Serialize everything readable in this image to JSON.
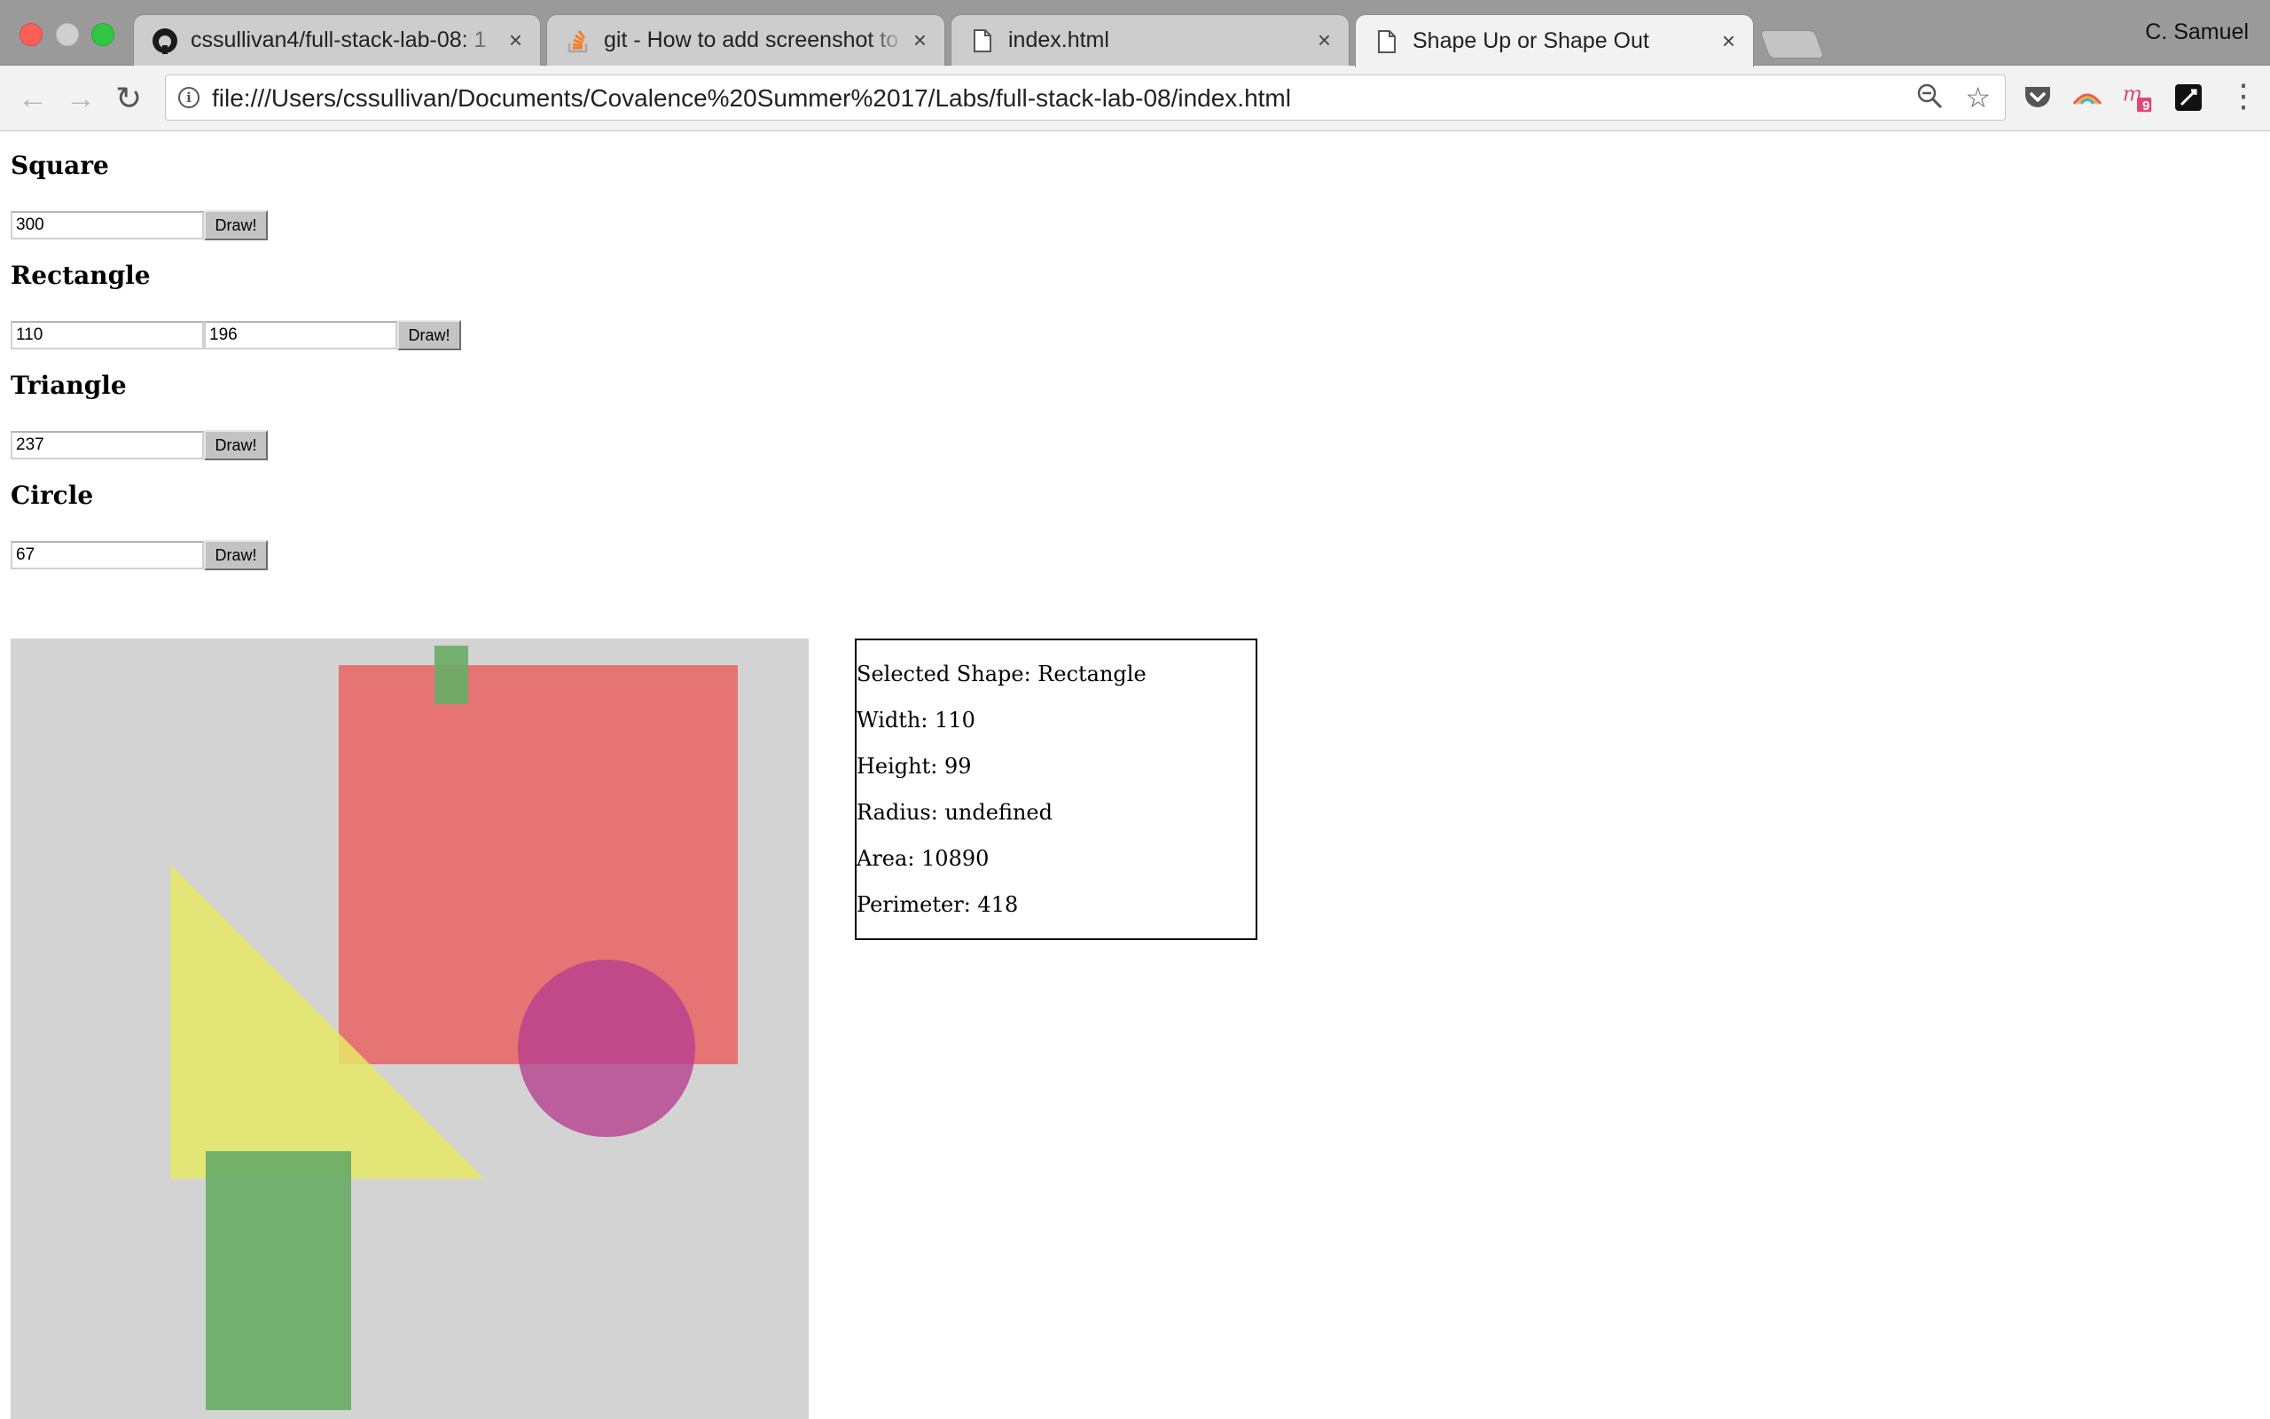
{
  "browser": {
    "tabs": [
      {
        "title": "cssullivan4/full-stack-lab-08: 1",
        "favicon": "github-icon"
      },
      {
        "title": "git - How to add screenshot to",
        "favicon": "stackoverflow-icon"
      },
      {
        "title": "index.html",
        "favicon": "document-icon"
      },
      {
        "title": "Shape Up or Shape Out",
        "favicon": "document-icon",
        "active": true
      }
    ],
    "close_glyph": "×",
    "profile_name": "C. Samuel",
    "url": "file:///Users/cssullivan/Documents/Covalence%20Summer%2017/Labs/full-stack-lab-08/index.html",
    "extension_badge": "9"
  },
  "form": {
    "square": {
      "heading": "Square",
      "side": "300",
      "button": "Draw!"
    },
    "rectangle": {
      "heading": "Rectangle",
      "width": "110",
      "height": "196",
      "button": "Draw!"
    },
    "triangle": {
      "heading": "Triangle",
      "height": "237",
      "button": "Draw!"
    },
    "circle": {
      "heading": "Circle",
      "radius": "67",
      "button": "Draw!"
    }
  },
  "canvas": {
    "background": "#d3d3d3",
    "shapes": [
      {
        "type": "square",
        "color": "#e86969"
      },
      {
        "type": "triangle",
        "color": "#e8e967"
      },
      {
        "type": "circle",
        "color": "#b7408f"
      },
      {
        "type": "rectangle",
        "color": "#6aac67"
      },
      {
        "type": "rectangle",
        "color": "#6aac67"
      }
    ]
  },
  "info": {
    "selected": "Selected Shape: Rectangle",
    "width": "Width: 110",
    "height": "Height: 99",
    "radius": "Radius: undefined",
    "area": "Area: 10890",
    "perimeter": "Perimeter: 418"
  }
}
